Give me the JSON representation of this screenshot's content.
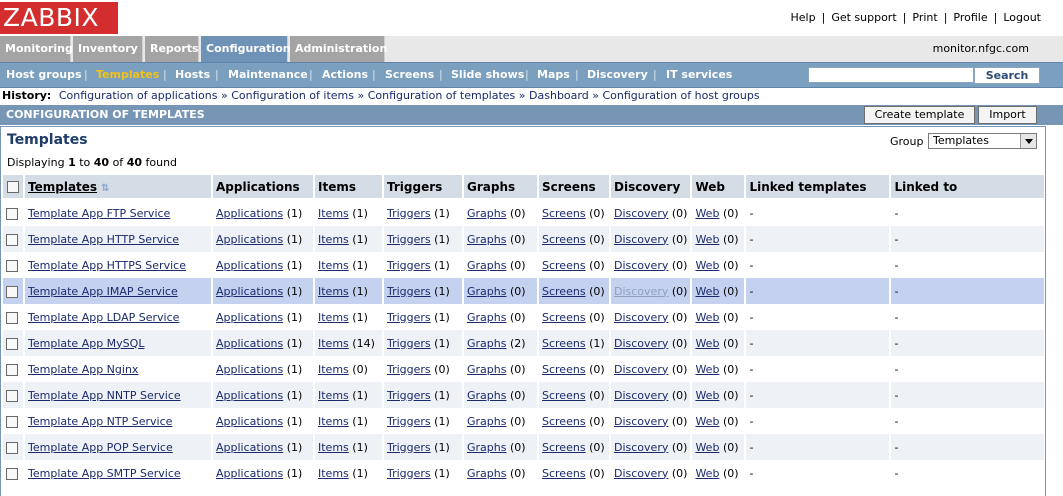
{
  "logo": "ZABBIX",
  "top_links": [
    "Help",
    "Get support",
    "Print",
    "Profile",
    "Logout"
  ],
  "main_tabs": [
    "Monitoring",
    "Inventory",
    "Reports",
    "Configuration",
    "Administration"
  ],
  "server_name": "monitor.nfgc.com",
  "sub_nav": [
    "Host groups",
    "Templates",
    "Hosts",
    "Maintenance",
    "Actions",
    "Screens",
    "Slide shows",
    "Maps",
    "Discovery",
    "IT services"
  ],
  "search": {
    "button": "Search",
    "value": ""
  },
  "history": {
    "label": "History:",
    "items": [
      "Configuration of applications",
      "Configuration of items",
      "Configuration of templates",
      "Dashboard",
      "Configuration of host groups"
    ]
  },
  "page_title": "CONFIGURATION OF TEMPLATES",
  "buttons": {
    "create": "Create template",
    "import": "Import"
  },
  "section": {
    "title": "Templates",
    "displaying": {
      "prefix": "Displaying",
      "from": "1",
      "to_word": "to",
      "to": "40",
      "of_word": "of",
      "total": "40",
      "suffix": "found"
    },
    "group_label": "Group",
    "group_value": "Templates"
  },
  "table": {
    "headers": [
      "Templates",
      "Applications",
      "Items",
      "Triggers",
      "Graphs",
      "Screens",
      "Discovery",
      "Web",
      "Linked templates",
      "Linked to"
    ],
    "rows": [
      {
        "name": "Template App FTP Service",
        "apps": "(1)",
        "items": "(1)",
        "triggers": "(1)",
        "graphs": "(0)",
        "screens": "(0)",
        "discovery": "(0)",
        "web": "(0)",
        "linked_templates": "-",
        "linked_to": "-"
      },
      {
        "name": "Template App HTTP Service",
        "apps": "(1)",
        "items": "(1)",
        "triggers": "(1)",
        "graphs": "(0)",
        "screens": "(0)",
        "discovery": "(0)",
        "web": "(0)",
        "linked_templates": "-",
        "linked_to": "-"
      },
      {
        "name": "Template App HTTPS Service",
        "apps": "(1)",
        "items": "(1)",
        "triggers": "(1)",
        "graphs": "(0)",
        "screens": "(0)",
        "discovery": "(0)",
        "web": "(0)",
        "linked_templates": "-",
        "linked_to": "-"
      },
      {
        "name": "Template App IMAP Service",
        "apps": "(1)",
        "items": "(1)",
        "triggers": "(1)",
        "graphs": "(0)",
        "screens": "(0)",
        "discovery": "(0)",
        "web": "(0)",
        "linked_templates": "-",
        "linked_to": "-"
      },
      {
        "name": "Template App LDAP Service",
        "apps": "(1)",
        "items": "(1)",
        "triggers": "(1)",
        "graphs": "(0)",
        "screens": "(0)",
        "discovery": "(0)",
        "web": "(0)",
        "linked_templates": "-",
        "linked_to": "-"
      },
      {
        "name": "Template App MySQL",
        "apps": "(1)",
        "items": "(14)",
        "triggers": "(1)",
        "graphs": "(2)",
        "screens": "(1)",
        "discovery": "(0)",
        "web": "(0)",
        "linked_templates": "-",
        "linked_to": "-"
      },
      {
        "name": "Template App Nginx",
        "apps": "(1)",
        "items": "(0)",
        "triggers": "(0)",
        "graphs": "(0)",
        "screens": "(0)",
        "discovery": "(0)",
        "web": "(0)",
        "linked_templates": "-",
        "linked_to": "-"
      },
      {
        "name": "Template App NNTP Service",
        "apps": "(1)",
        "items": "(1)",
        "triggers": "(1)",
        "graphs": "(0)",
        "screens": "(0)",
        "discovery": "(0)",
        "web": "(0)",
        "linked_templates": "-",
        "linked_to": "-"
      },
      {
        "name": "Template App NTP Service",
        "apps": "(1)",
        "items": "(1)",
        "triggers": "(1)",
        "graphs": "(0)",
        "screens": "(0)",
        "discovery": "(0)",
        "web": "(0)",
        "linked_templates": "-",
        "linked_to": "-"
      },
      {
        "name": "Template App POP Service",
        "apps": "(1)",
        "items": "(1)",
        "triggers": "(1)",
        "graphs": "(0)",
        "screens": "(0)",
        "discovery": "(0)",
        "web": "(0)",
        "linked_templates": "-",
        "linked_to": "-"
      },
      {
        "name": "Template App SMTP Service",
        "apps": "(1)",
        "items": "(1)",
        "triggers": "(1)",
        "graphs": "(0)",
        "screens": "(0)",
        "discovery": "(0)",
        "web": "(0)",
        "linked_templates": "-",
        "linked_to": "-"
      }
    ],
    "highlighted_row": 3,
    "link_words": {
      "apps": "Applications",
      "items": "Items",
      "triggers": "Triggers",
      "graphs": "Graphs",
      "screens": "Screens",
      "discovery": "Discovery",
      "web": "Web"
    }
  },
  "colors": {
    "logo": "#d42d2d",
    "active_tab": "#6f93b7",
    "subnav": "#7b9fbe",
    "active_subnav": "#f2c21c",
    "title_bar": "#7796b6",
    "row_highlight": "#c4d2f0"
  }
}
